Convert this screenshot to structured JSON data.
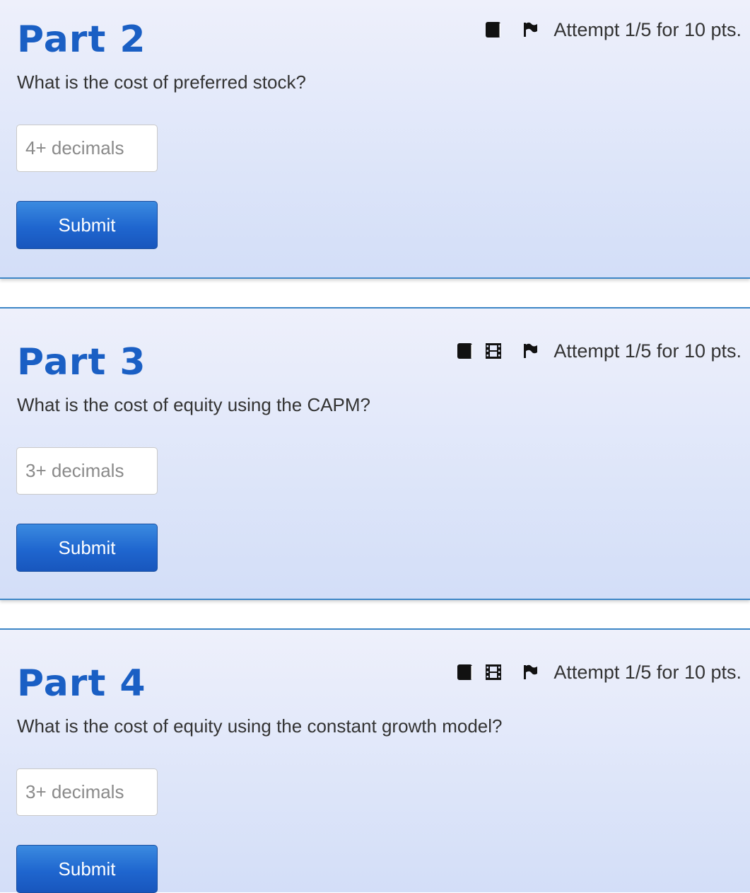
{
  "parts": [
    {
      "title": "Part 2",
      "question": "What is the cost of preferred stock?",
      "input_placeholder": "4+ decimals",
      "input_value": "",
      "submit_label": "Submit",
      "attempt_text": "Attempt 1/5 for 10 pts.",
      "icons": [
        "book-icon",
        "flag-icon"
      ]
    },
    {
      "title": "Part 3",
      "question": "What is the cost of equity using the CAPM?",
      "input_placeholder": "3+ decimals",
      "input_value": "",
      "submit_label": "Submit",
      "attempt_text": "Attempt 1/5 for 10 pts.",
      "icons": [
        "book-icon",
        "film-icon",
        "flag-icon"
      ]
    },
    {
      "title": "Part 4",
      "question": "What is the cost of equity using the constant growth model?",
      "input_placeholder": "3+ decimals",
      "input_value": "",
      "submit_label": "Submit",
      "attempt_text": "Attempt 1/5 for 10 pts.",
      "icons": [
        "book-icon",
        "film-icon",
        "flag-icon"
      ]
    }
  ],
  "colors": {
    "title": "#1a5fc4",
    "panel_top": "#eef0fb",
    "panel_bottom": "#d3def8",
    "divider": "#3d86c6",
    "button_top": "#3b8be0",
    "button_bottom": "#1856bd"
  }
}
